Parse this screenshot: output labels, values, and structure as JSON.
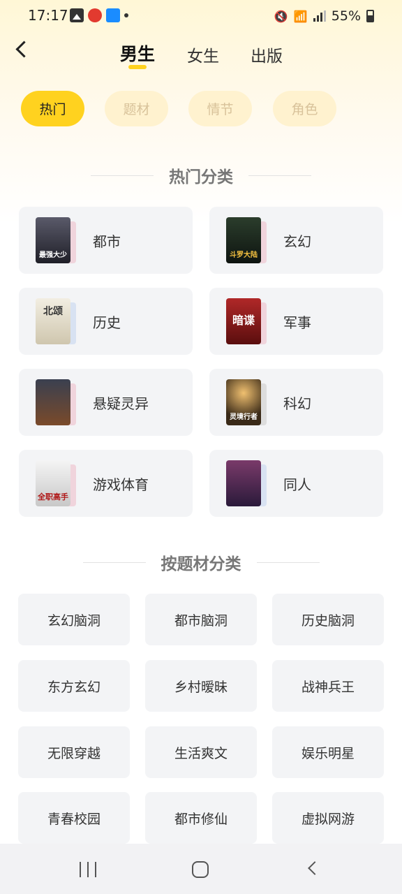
{
  "status": {
    "time": "17:17",
    "battery": "55%"
  },
  "header": {
    "tabs": [
      {
        "label": "男生",
        "active": true
      },
      {
        "label": "女生",
        "active": false
      },
      {
        "label": "出版",
        "active": false
      }
    ]
  },
  "filters": [
    {
      "label": "热门",
      "active": true
    },
    {
      "label": "题材",
      "active": false
    },
    {
      "label": "情节",
      "active": false
    },
    {
      "label": "角色",
      "active": false
    }
  ],
  "hot_section": {
    "title": "热门分类",
    "categories": [
      {
        "label": "都市",
        "cover_text": "最强大少",
        "cover_color": "#3a3a48"
      },
      {
        "label": "玄幻",
        "cover_text": "斗罗大陆",
        "cover_color": "#1c2a20"
      },
      {
        "label": "历史",
        "cover_text": "北颂",
        "cover_color": "#e9e3d2"
      },
      {
        "label": "军事",
        "cover_text": "暗谍",
        "cover_color": "#8b1c1c"
      },
      {
        "label": "悬疑灵异",
        "cover_text": "",
        "cover_color": "#2a2f3a"
      },
      {
        "label": "科幻",
        "cover_text": "灵境行者",
        "cover_color": "#3a2a18"
      },
      {
        "label": "游戏体育",
        "cover_text": "全职高手",
        "cover_color": "#d8d8d8"
      },
      {
        "label": "同人",
        "cover_text": "",
        "cover_color": "#5a2a4a"
      }
    ]
  },
  "theme_section": {
    "title": "按题材分类",
    "items": [
      "玄幻脑洞",
      "都市脑洞",
      "历史脑洞",
      "东方玄幻",
      "乡村暧昧",
      "战神兵王",
      "无限穿越",
      "生活爽文",
      "娱乐明星",
      "青春校园",
      "都市修仙",
      "虚拟网游"
    ]
  },
  "colors": {
    "accent": "#ffd21f",
    "card_bg": "#f3f4f6"
  }
}
